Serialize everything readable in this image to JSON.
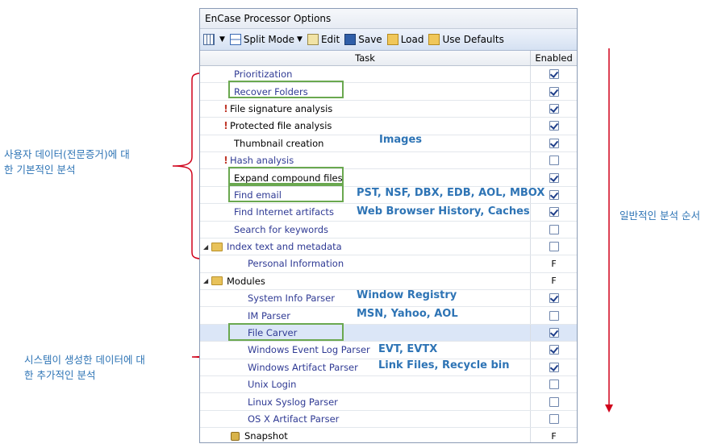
{
  "window": {
    "title": "EnCase Processor Options"
  },
  "toolbar": {
    "split_mode": "Split Mode",
    "edit": "Edit",
    "save": "Save",
    "load": "Load",
    "use_defaults": "Use Defaults"
  },
  "columns": {
    "task": "Task",
    "enabled": "Enabled"
  },
  "rows": [
    {
      "label": "Prioritization",
      "enabled": "checked"
    },
    {
      "label": "Recover Folders",
      "enabled": "checked"
    },
    {
      "label": "File signature analysis",
      "enabled": "checked"
    },
    {
      "label": "Protected file analysis",
      "enabled": "checked"
    },
    {
      "label": "Thumbnail creation",
      "enabled": "checked"
    },
    {
      "label": "Hash analysis",
      "enabled": "unchecked"
    },
    {
      "label": "Expand compound files",
      "enabled": "checked"
    },
    {
      "label": "Find email",
      "enabled": "checked"
    },
    {
      "label": "Find Internet artifacts",
      "enabled": "checked"
    },
    {
      "label": "Search for keywords",
      "enabled": "unchecked"
    },
    {
      "label": "Index text and metadata",
      "enabled": "unchecked"
    },
    {
      "label": "Personal Information",
      "enabled": "F"
    },
    {
      "label": "Modules",
      "enabled": "F"
    },
    {
      "label": "System Info Parser",
      "enabled": "checked"
    },
    {
      "label": "IM Parser",
      "enabled": "unchecked"
    },
    {
      "label": "File Carver",
      "enabled": "checked"
    },
    {
      "label": "Windows Event Log Parser",
      "enabled": "checked"
    },
    {
      "label": "Windows Artifact Parser",
      "enabled": "checked"
    },
    {
      "label": "Unix Login",
      "enabled": "unchecked"
    },
    {
      "label": "Linux Syslog Parser",
      "enabled": "unchecked"
    },
    {
      "label": "OS X Artifact Parser",
      "enabled": "unchecked"
    },
    {
      "label": "Snapshot",
      "enabled": "F"
    }
  ],
  "annotations": {
    "images": "Images",
    "email": "PST, NSF, DBX, EDB, AOL, MBOX",
    "web": "Web Browser History, Caches",
    "registry": "Window Registry",
    "im": "MSN, Yahoo, AOL",
    "evt": "EVT, EVTX",
    "artifact": "Link Files, Recycle bin"
  },
  "side_labels": {
    "user_line1": "사용자 데이터(전문증거)에 대",
    "user_line2": "한 기본적인 분석",
    "system_line1": "시스템이 생성한 데이터에 대",
    "system_line2": "한 추가적인 분석",
    "order": "일반적인 분석 순서"
  },
  "colors": {
    "annotation": "#2e74b5",
    "highlight_box": "#6aa84f",
    "bracket": "#d0021b",
    "task_text": "#2f3a94"
  }
}
